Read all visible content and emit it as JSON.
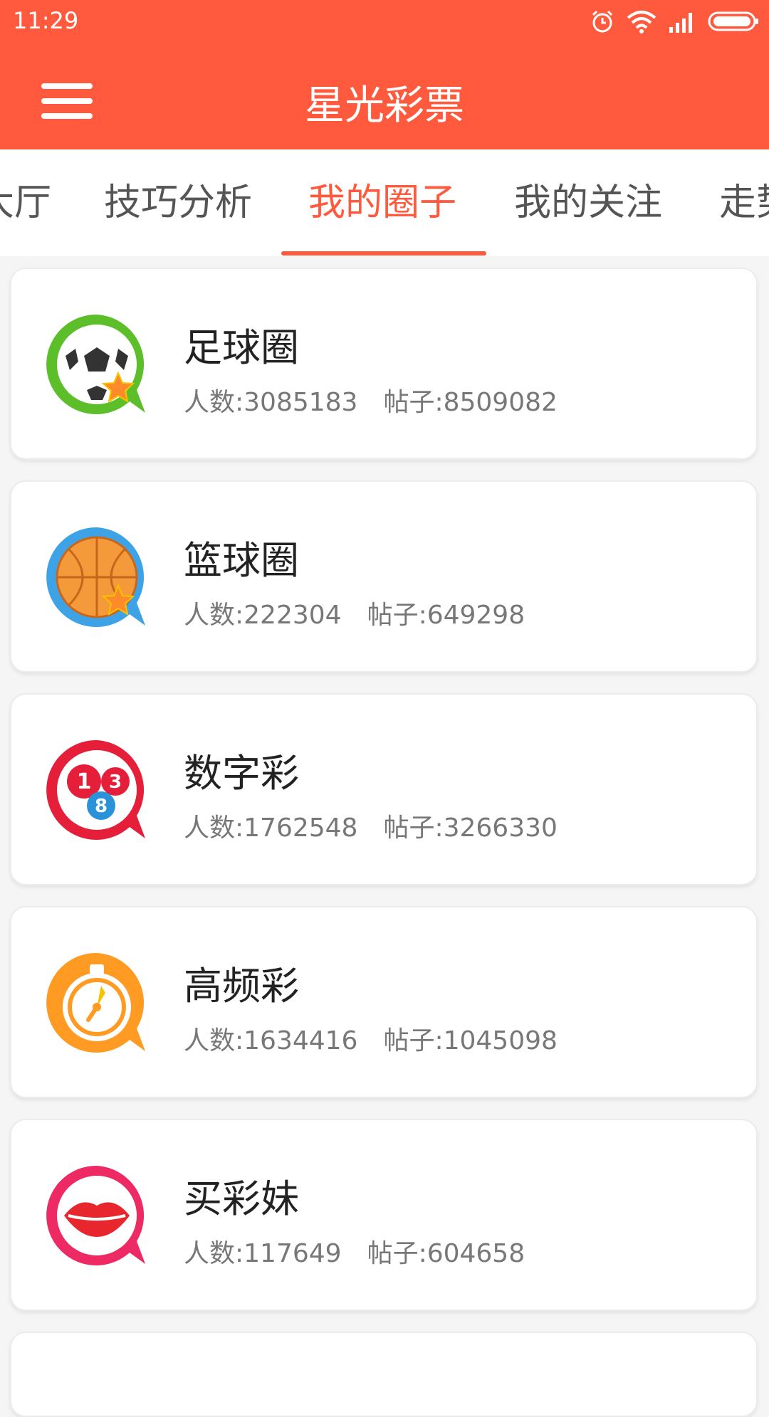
{
  "status_bar": {
    "time": "11:29",
    "icons": [
      "alarm-icon",
      "wifi-icon",
      "signal-icon",
      "battery-icon"
    ]
  },
  "app_bar": {
    "title": "星光彩票",
    "menu_icon": "hamburger-menu-icon"
  },
  "tabs": [
    {
      "label": "大厅"
    },
    {
      "label": "技巧分析"
    },
    {
      "label": "我的圈子"
    },
    {
      "label": "我的关注"
    },
    {
      "label": "走势"
    }
  ],
  "active_tab": "我的圈子",
  "circles": [
    {
      "name": "足球圈",
      "members": "人数:3085183",
      "posts": "帖子:8509082",
      "icon": "soccer-circle-icon",
      "color": "#5cbf2a"
    },
    {
      "name": "篮球圈",
      "members": "人数:222304",
      "posts": "帖子:649298",
      "icon": "basketball-circle-icon",
      "color": "#3ea3e6"
    },
    {
      "name": "数字彩",
      "members": "人数:1762548",
      "posts": "帖子:3266330",
      "icon": "numbers-lottery-circle-icon",
      "color": "#e51e3a"
    },
    {
      "name": "高频彩",
      "members": "人数:1634416",
      "posts": "帖子:1045098",
      "icon": "stopwatch-circle-icon",
      "color": "#ff9b22"
    },
    {
      "name": "买彩妹",
      "members": "人数:117649",
      "posts": "帖子:604658",
      "icon": "lips-circle-icon",
      "color": "#ee2a64"
    }
  ],
  "colors": {
    "accent": "#ff5a3d",
    "tab_inactive": "#555555",
    "stat_text": "#777777"
  }
}
